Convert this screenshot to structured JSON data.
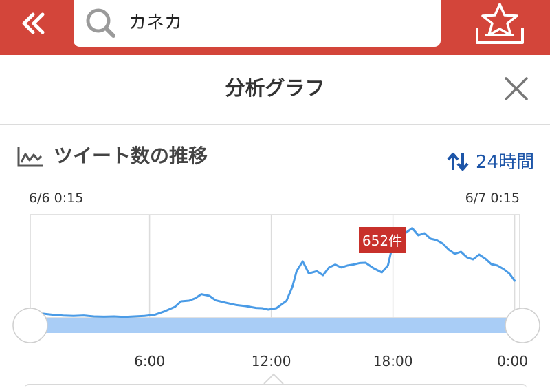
{
  "header": {
    "search_value": "カネカ",
    "back_icon": "double-chevron-left-icon",
    "search_icon": "search-icon",
    "favorite_icon": "star-tray-icon",
    "accent_color": "#d3453a"
  },
  "subheader": {
    "title": "分析グラフ",
    "close_icon": "close-icon"
  },
  "panel": {
    "title": "ツイート数の推移",
    "title_icon": "line-chart-icon",
    "range_label": "24時間",
    "range_icon": "sort-arrows-icon",
    "start_label": "6/6 0:15",
    "end_label": "6/7 0:15",
    "tooltip_label": "652件"
  },
  "chart_data": {
    "type": "line",
    "x_tick_labels": [
      "6:00",
      "12:00",
      "18:00",
      "0:00"
    ],
    "x_ticks_hours": [
      5.75,
      11.75,
      17.75,
      23.75
    ],
    "xlim_hours": [
      0,
      24
    ],
    "ylim": [
      0,
      750
    ],
    "grid": "vertical",
    "line_color": "#4a9be6",
    "range_selector_color": "#a9cdf6",
    "tooltip_color": "#c8312b",
    "tooltip_value": 652,
    "series": [
      {
        "values": [
          [
            0.0,
            38
          ],
          [
            0.5,
            30
          ],
          [
            1.0,
            22
          ],
          [
            1.5,
            16
          ],
          [
            2.0,
            14
          ],
          [
            2.5,
            17
          ],
          [
            3.0,
            10
          ],
          [
            3.5,
            8
          ],
          [
            4.0,
            10
          ],
          [
            4.5,
            6
          ],
          [
            5.0,
            10
          ],
          [
            5.5,
            14
          ],
          [
            6.0,
            22
          ],
          [
            6.5,
            48
          ],
          [
            7.0,
            80
          ],
          [
            7.3,
            120
          ],
          [
            7.7,
            125
          ],
          [
            8.0,
            142
          ],
          [
            8.3,
            172
          ],
          [
            8.7,
            160
          ],
          [
            9.0,
            128
          ],
          [
            9.5,
            110
          ],
          [
            10.0,
            94
          ],
          [
            10.5,
            85
          ],
          [
            11.0,
            72
          ],
          [
            11.3,
            70
          ],
          [
            11.6,
            60
          ],
          [
            12.0,
            70
          ],
          [
            12.5,
            124
          ],
          [
            12.8,
            230
          ],
          [
            13.0,
            340
          ],
          [
            13.3,
            410
          ],
          [
            13.6,
            323
          ],
          [
            14.0,
            339
          ],
          [
            14.3,
            310
          ],
          [
            14.6,
            366
          ],
          [
            14.9,
            387
          ],
          [
            15.2,
            366
          ],
          [
            15.5,
            380
          ],
          [
            15.8,
            387
          ],
          [
            16.1,
            398
          ],
          [
            16.4,
            400
          ],
          [
            16.8,
            360
          ],
          [
            17.2,
            330
          ],
          [
            17.5,
            380
          ],
          [
            17.8,
            570
          ],
          [
            18.1,
            600
          ],
          [
            18.4,
            620
          ],
          [
            18.7,
            652
          ],
          [
            19.0,
            600
          ],
          [
            19.3,
            615
          ],
          [
            19.6,
            575
          ],
          [
            19.9,
            565
          ],
          [
            20.2,
            540
          ],
          [
            20.5,
            495
          ],
          [
            20.8,
            465
          ],
          [
            21.1,
            480
          ],
          [
            21.4,
            440
          ],
          [
            21.7,
            425
          ],
          [
            22.0,
            460
          ],
          [
            22.3,
            430
          ],
          [
            22.6,
            390
          ],
          [
            22.9,
            380
          ],
          [
            23.2,
            355
          ],
          [
            23.5,
            320
          ],
          [
            23.75,
            270
          ]
        ]
      }
    ]
  }
}
